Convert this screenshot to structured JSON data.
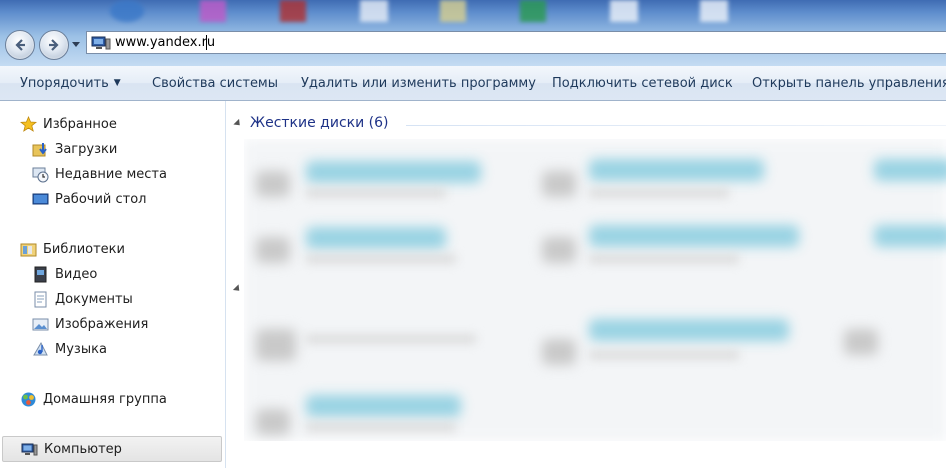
{
  "address_bar": {
    "url": "www.yandex.ru"
  },
  "toolbar": {
    "organize_label": "Упорядочить",
    "system_properties_label": "Свойства системы",
    "uninstall_label": "Удалить или изменить программу",
    "map_drive_label": "Подключить сетевой диск",
    "control_panel_label": "Открыть панель управления"
  },
  "sidebar": {
    "favorites": {
      "label": "Избранное",
      "items": [
        {
          "label": "Загрузки"
        },
        {
          "label": "Недавние места"
        },
        {
          "label": "Рабочий стол"
        }
      ]
    },
    "libraries": {
      "label": "Библиотеки",
      "items": [
        {
          "label": "Видео"
        },
        {
          "label": "Документы"
        },
        {
          "label": "Изображения"
        },
        {
          "label": "Музыка"
        }
      ]
    },
    "homegroup": {
      "label": "Домашняя группа"
    },
    "computer": {
      "label": "Компьютер"
    }
  },
  "content": {
    "hard_drives_group": "Жесткие диски (6)"
  },
  "colors": {
    "group_title": "#1e3287",
    "command_text": "#1e395b",
    "drive_bar": "#8fcfe1"
  }
}
